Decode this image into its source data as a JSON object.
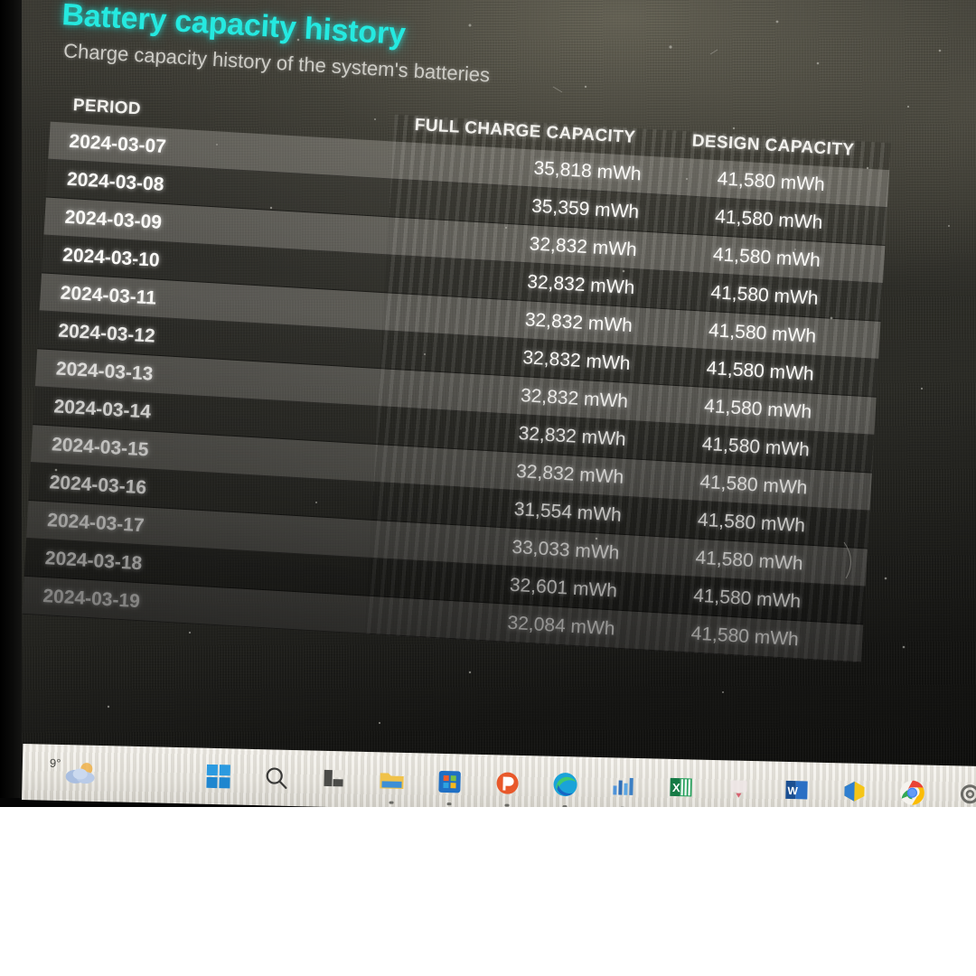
{
  "app": {
    "platform": "Windows",
    "screen_context": "photo of a laptop screen showing a battery report"
  },
  "header": {
    "title": "Battery capacity history",
    "subtitle": "Charge capacity history of the system's batteries",
    "title_color": "#25e9e0",
    "subtitle_color": "#cdccc6"
  },
  "table": {
    "columns": [
      "PERIOD",
      "FULL CHARGE CAPACITY",
      "DESIGN CAPACITY"
    ],
    "rows": [
      {
        "period": "2024-03-07",
        "full_charge": "35,818 mWh",
        "design": "41,580 mWh"
      },
      {
        "period": "2024-03-08",
        "full_charge": "35,359 mWh",
        "design": "41,580 mWh"
      },
      {
        "period": "2024-03-09",
        "full_charge": "32,832 mWh",
        "design": "41,580 mWh"
      },
      {
        "period": "2024-03-10",
        "full_charge": "32,832 mWh",
        "design": "41,580 mWh"
      },
      {
        "period": "2024-03-11",
        "full_charge": "32,832 mWh",
        "design": "41,580 mWh"
      },
      {
        "period": "2024-03-12",
        "full_charge": "32,832 mWh",
        "design": "41,580 mWh"
      },
      {
        "period": "2024-03-13",
        "full_charge": "32,832 mWh",
        "design": "41,580 mWh"
      },
      {
        "period": "2024-03-14",
        "full_charge": "32,832 mWh",
        "design": "41,580 mWh"
      },
      {
        "period": "2024-03-15",
        "full_charge": "32,832 mWh",
        "design": "41,580 mWh"
      },
      {
        "period": "2024-03-16",
        "full_charge": "31,554 mWh",
        "design": "41,580 mWh"
      },
      {
        "period": "2024-03-17",
        "full_charge": "33,033 mWh",
        "design": "41,580 mWh"
      },
      {
        "period": "2024-03-18",
        "full_charge": "32,601 mWh",
        "design": "41,580 mWh"
      },
      {
        "period": "2024-03-19",
        "full_charge": "32,084 mWh",
        "design": "41,580 mWh"
      }
    ]
  },
  "taskbar": {
    "weather": {
      "temperature": "9°",
      "icon": "partly-cloudy-icon"
    },
    "items": [
      {
        "name": "start-button",
        "label": "Start"
      },
      {
        "name": "search-button",
        "label": "Search"
      },
      {
        "name": "task-view-button",
        "label": "Task View"
      },
      {
        "name": "file-explorer-button",
        "label": "File Explorer"
      },
      {
        "name": "microsoft-store-button",
        "label": "Microsoft Store"
      },
      {
        "name": "powerpoint-button",
        "label": "PowerPoint"
      },
      {
        "name": "edge-button",
        "label": "Microsoft Edge"
      },
      {
        "name": "app-blue-button",
        "label": "App"
      },
      {
        "name": "excel-button",
        "label": "Excel"
      },
      {
        "name": "app-pink-button",
        "label": "App"
      },
      {
        "name": "word-button",
        "label": "Word"
      },
      {
        "name": "app-yellow-button",
        "label": "App"
      },
      {
        "name": "chrome-button",
        "label": "Google Chrome"
      },
      {
        "name": "settings-button",
        "label": "Settings"
      }
    ]
  }
}
